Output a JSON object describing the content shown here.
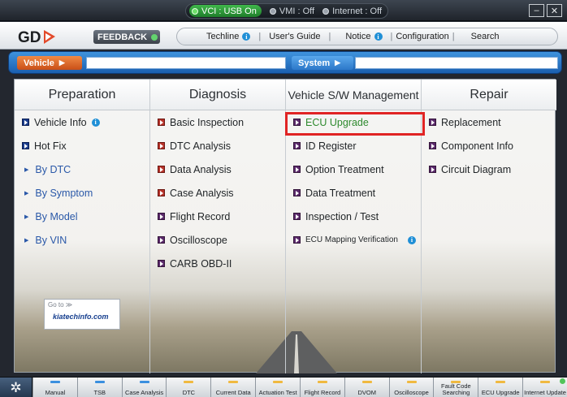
{
  "statusbar": {
    "vci_label": "VCI : USB On",
    "vmi_label": "VMI : Off",
    "internet_label": "Internet : Off",
    "minimize": "–",
    "close": "✕"
  },
  "topbar": {
    "logo_text": "GD",
    "feedback_label": "FEEDBACK",
    "menu": [
      "Techline",
      "User's Guide",
      "Notice",
      "Configuration",
      "Search"
    ],
    "info_glyph": "i"
  },
  "selectors": {
    "vehicle_label": "Vehicle",
    "vehicle_value": "",
    "system_label": "System",
    "system_value": "",
    "arrow": "▶"
  },
  "columns": [
    {
      "title": "Preparation",
      "items": [
        "Vehicle Info",
        "Hot Fix",
        "By DTC",
        "By Symptom",
        "By Model",
        "By VIN"
      ]
    },
    {
      "title": "Diagnosis",
      "items": [
        "Basic Inspection",
        "DTC Analysis",
        "Data Analysis",
        "Case Analysis",
        "Flight Record",
        "Oscilloscope",
        "CARB OBD-II"
      ]
    },
    {
      "title": "Vehicle S/W Management",
      "items": [
        "ECU Upgrade",
        "ID Register",
        "Option Treatment",
        "Data Treatment",
        "Inspection / Test",
        "ECU Mapping Verification"
      ]
    },
    {
      "title": "Repair",
      "items": [
        "Replacement",
        "Component Info",
        "Circuit Diagram"
      ]
    }
  ],
  "badge": {
    "goto": "Go to ≫",
    "site": "kiatechinfo.com"
  },
  "toolbar": {
    "asterisk": "✲",
    "buttons": [
      "Manual",
      "TSB",
      "Case Analysis",
      "DTC",
      "Current Data",
      "Actuation Test",
      "Flight Record",
      "DVOM",
      "Oscilloscope",
      "Fault Code Searching",
      "ECU Upgrade",
      "Internet Update"
    ]
  },
  "colors": {
    "accent_blue": "#2a74c8",
    "vehicle_orange": "#e06a2a",
    "highlight_red": "#e02424",
    "ecu_upgrade_green": "#2e8a2e"
  }
}
